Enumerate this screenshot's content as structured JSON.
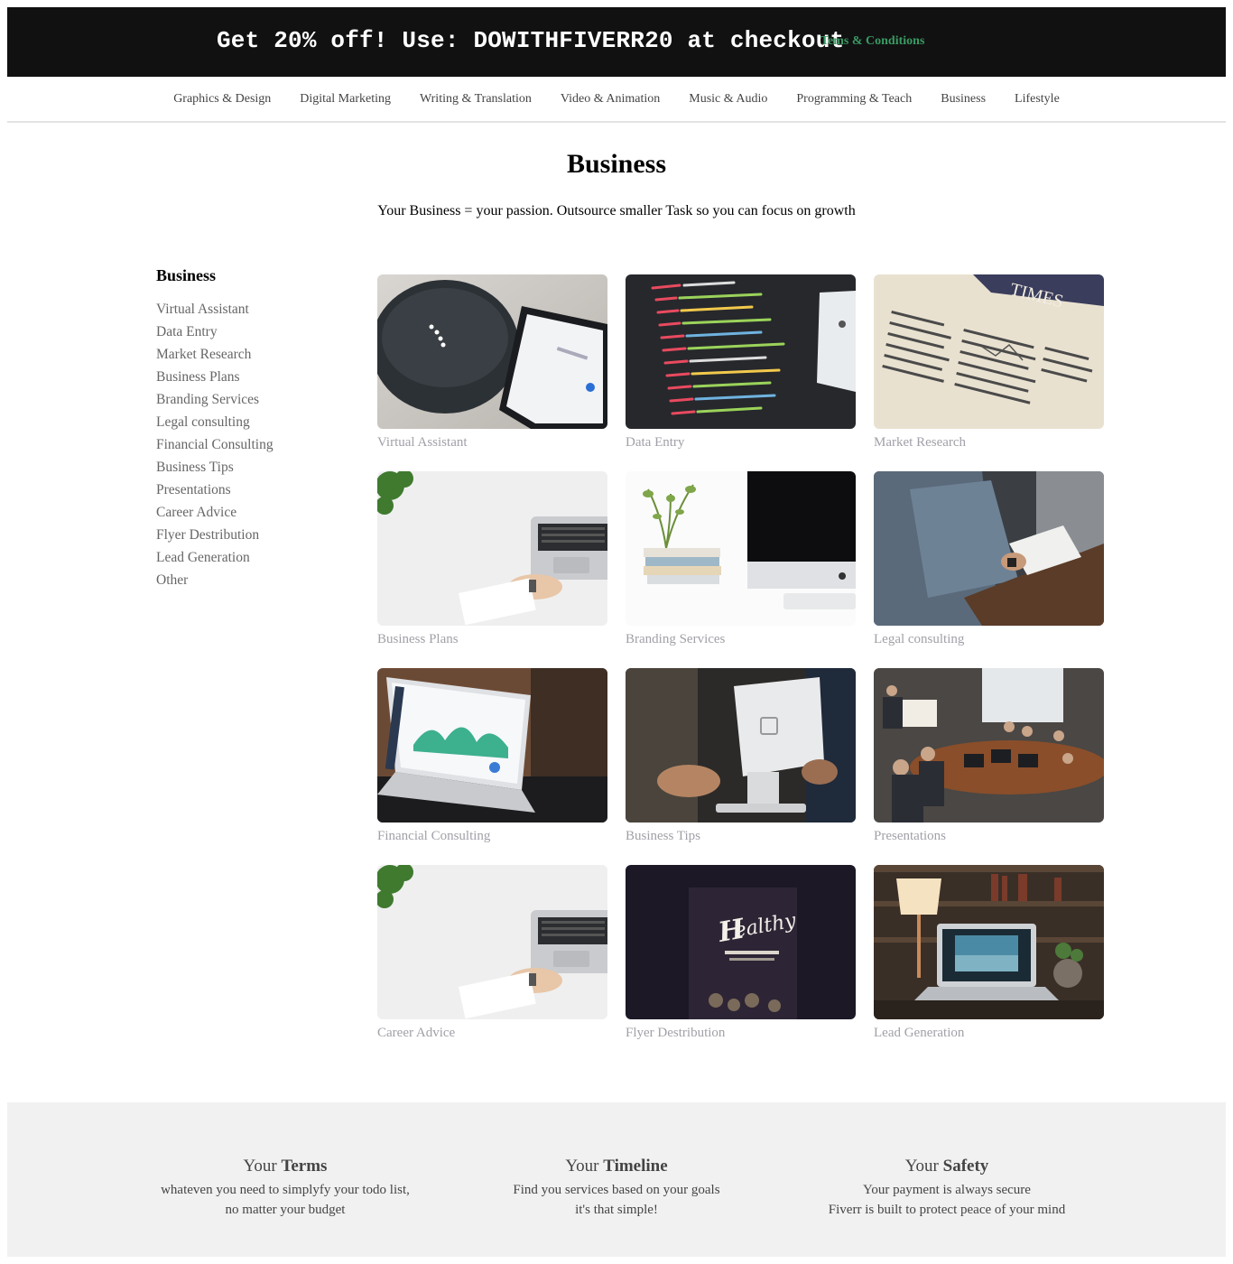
{
  "promo": {
    "text": "Get 20% off! Use: DOWITHFIVERR20 at checkout",
    "terms_link": "Tems & Conditions",
    "terms_color": "#3a9a63"
  },
  "nav": {
    "items": [
      {
        "label": "Graphics & Design"
      },
      {
        "label": "Digital Marketing"
      },
      {
        "label": "Writing & Translation"
      },
      {
        "label": "Video & Animation"
      },
      {
        "label": "Music & Audio"
      },
      {
        "label": "Programming & Teach"
      },
      {
        "label": "Business"
      },
      {
        "label": "Lifestyle"
      }
    ]
  },
  "header": {
    "title": "Business",
    "subtitle": "Your Business = your passion. Outsource smaller Task so you can focus on growth"
  },
  "sidebar": {
    "heading": "Business",
    "items": [
      {
        "label": "Virtual Assistant"
      },
      {
        "label": "Data Entry"
      },
      {
        "label": "Market Research"
      },
      {
        "label": "Business Plans"
      },
      {
        "label": "Branding Services"
      },
      {
        "label": "Legal consulting"
      },
      {
        "label": "Financial Consulting"
      },
      {
        "label": "Business Tips"
      },
      {
        "label": "Presentations"
      },
      {
        "label": "Career Advice"
      },
      {
        "label": "Flyer Destribution"
      },
      {
        "label": "Lead Generation"
      },
      {
        "label": "Other"
      }
    ]
  },
  "cards": [
    {
      "label": "Virtual Assistant",
      "image": "smart-speaker-phone-photo"
    },
    {
      "label": "Data Entry",
      "image": "code-screen-photo"
    },
    {
      "label": "Market Research",
      "image": "newspaper-photo"
    },
    {
      "label": "Business Plans",
      "image": "desk-laptop-hands-photo"
    },
    {
      "label": "Branding Services",
      "image": "desk-imac-books-photo"
    },
    {
      "label": "Legal consulting",
      "image": "meeting-table-photo"
    },
    {
      "label": "Financial Consulting",
      "image": "laptop-analytics-photo"
    },
    {
      "label": "Business Tips",
      "image": "pos-terminal-photo"
    },
    {
      "label": "Presentations",
      "image": "conference-room-photo"
    },
    {
      "label": "Career Advice",
      "image": "desk-laptop-hands-photo"
    },
    {
      "label": "Flyer Destribution",
      "image": "healthy-food-sign-photo"
    },
    {
      "label": "Lead Generation",
      "image": "laptop-lamp-desk-photo"
    }
  ],
  "footer": {
    "features": [
      {
        "prefix": "Your ",
        "bold": "Terms",
        "line1": "whateven you need to simplyfy your todo list,",
        "line2": "no matter your budget"
      },
      {
        "prefix": "Your ",
        "bold": "Timeline",
        "line1": "Find you services based on your goals",
        "line2": "it's that simple!"
      },
      {
        "prefix": "Your ",
        "bold": "Safety",
        "line1": "Your payment is always secure",
        "line2": "Fiverr is built to protect peace of your mind"
      }
    ]
  }
}
